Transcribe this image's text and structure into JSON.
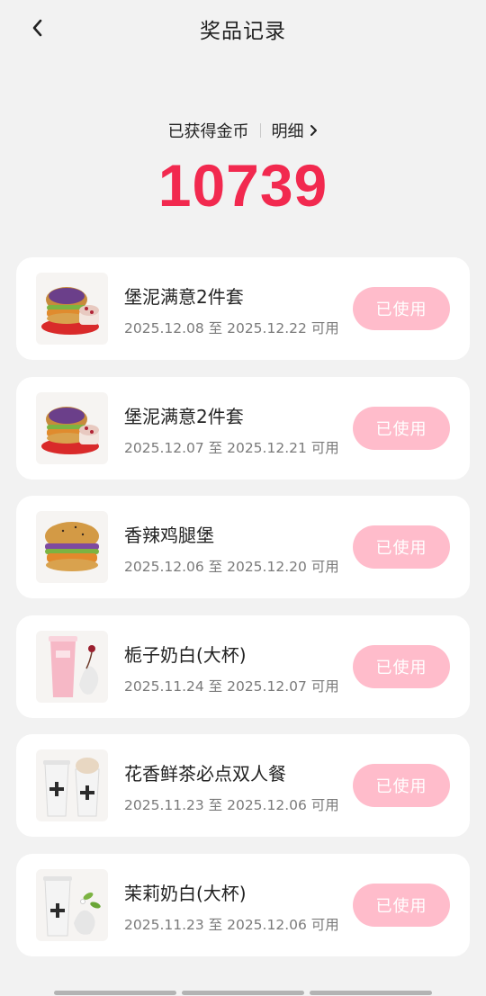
{
  "header": {
    "title": "奖品记录",
    "back_icon": "chevron-left-icon"
  },
  "summary": {
    "earned_label": "已获得金币",
    "detail_label": "明细",
    "coins": "10739",
    "accent_color": "#f2294f"
  },
  "rewards": [
    {
      "name": "堡泥满意2件套",
      "validity": "2025.12.08 至 2025.12.22 可用",
      "status": "已使用",
      "image": "burger-combo-image"
    },
    {
      "name": "堡泥满意2件套",
      "validity": "2025.12.07 至 2025.12.21 可用",
      "status": "已使用",
      "image": "burger-combo-image"
    },
    {
      "name": "香辣鸡腿堡",
      "validity": "2025.12.06 至 2025.12.20 可用",
      "status": "已使用",
      "image": "chicken-burger-image"
    },
    {
      "name": "栀子奶白(大杯)",
      "validity": "2025.11.24 至 2025.12.07 可用",
      "status": "已使用",
      "image": "pink-milk-tea-image"
    },
    {
      "name": "花香鲜茶必点双人餐",
      "validity": "2025.11.23 至 2025.12.06 可用",
      "status": "已使用",
      "image": "double-tea-image"
    },
    {
      "name": "茉莉奶白(大杯)",
      "validity": "2025.11.23 至 2025.12.06 可用",
      "status": "已使用",
      "image": "jasmine-milk-tea-image"
    }
  ],
  "colors": {
    "used_button": "#ffbccb",
    "background": "#f2f2f2"
  }
}
